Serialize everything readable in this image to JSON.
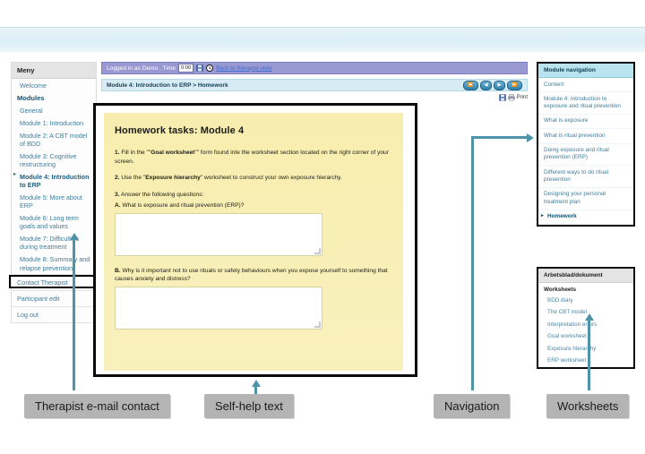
{
  "left_menu": {
    "header": "Meny",
    "welcome": "Welcome",
    "modules_header": "Modules",
    "items": [
      {
        "label": "General",
        "selected": false
      },
      {
        "label": "Module 1: Introduction",
        "selected": false
      },
      {
        "label": "Module 2: A CBT model of BDD",
        "selected": false
      },
      {
        "label": "Module 3: Cognitive restructuring",
        "selected": false
      },
      {
        "label": "Module 4: Introduction to ERP",
        "selected": true
      },
      {
        "label": "Module 5: More about ERP",
        "selected": false
      },
      {
        "label": "Module 6: Long term goals and values",
        "selected": false
      },
      {
        "label": "Module 7: Difficulties during treatment",
        "selected": false
      },
      {
        "label": "Module 8: Summary and relapse prevention",
        "selected": false
      }
    ],
    "footer_items": [
      {
        "label": "Contact Therapist"
      },
      {
        "label": "Participant edit"
      },
      {
        "label": "Log out"
      }
    ]
  },
  "session_bar": {
    "logged_in_text": "Logged in as Demo . Time",
    "time_value": "0:00",
    "save_icon": "save-icon",
    "clock_icon": "clock-icon",
    "back_link": "Back to therapist view"
  },
  "breadcrumb": {
    "text": "Module 4: Introduction to ERP > Homework",
    "nav_buttons": [
      {
        "name": "first-page-button",
        "glyph": "⏪"
      },
      {
        "name": "previous-page-button",
        "glyph": "◀"
      },
      {
        "name": "next-page-button",
        "glyph": "▶"
      },
      {
        "name": "last-page-button",
        "glyph": "⏩"
      }
    ],
    "print_label": "Print",
    "save_icon": "save-icon",
    "print_icon": "printer-icon"
  },
  "homework": {
    "title": "Homework tasks: Module 4",
    "task1_prefix": "1.",
    "task1_a": "Fill in the \"\"",
    "task1_bold": "Goal worksheet",
    "task1_b": "\"\" form found inte the worksheet section located on the right corner of your screen.",
    "task2_prefix": "2.",
    "task2_a": "Use the \"",
    "task2_bold": "Exposure hierarchy",
    "task2_b": "\" worksheet to construct your own exposure hierarchy.",
    "task3_prefix": "3.",
    "task3_text": "Answer the following questions:",
    "qa_label": "A.",
    "qa_text": "What is exposure and ritual prevention (ERP)?",
    "qa_value": "",
    "qb_label": "B.",
    "qb_text": "Why is it important not to use rituals or safety behaviours when you expose yourself to something that causes anxiety and distress?",
    "qb_value": ""
  },
  "module_nav": {
    "header": "Module navigation",
    "items": [
      {
        "label": "Content",
        "selected": false
      },
      {
        "label": "Module 4: Introduction to exposure and ritual prevention",
        "selected": false
      },
      {
        "label": "What is exposure",
        "selected": false
      },
      {
        "label": "What is ritual prevention",
        "selected": false
      },
      {
        "label": "Doing exposure and ritual prevention (ERP)",
        "selected": false
      },
      {
        "label": "Different ways to do ritual prevention",
        "selected": false
      },
      {
        "label": "Designing your personal treatment plan",
        "selected": false
      },
      {
        "label": "Homework",
        "selected": true
      }
    ]
  },
  "worksheets_panel": {
    "header": "Arbetsblad/dokument",
    "subheader": "Worksheets",
    "items": [
      {
        "label": "BDD diary"
      },
      {
        "label": "The CBT model"
      },
      {
        "label": "Interpretation errors"
      },
      {
        "label": "Goal worksheet"
      },
      {
        "label": "Exposure hierarchy"
      },
      {
        "label": "ERP worksheet"
      }
    ]
  },
  "annotations": [
    {
      "label": "Therapist e-mail contact"
    },
    {
      "label": "Self-help text"
    },
    {
      "label": "Navigation"
    },
    {
      "label": "Worksheets"
    }
  ],
  "colors": {
    "session_bar": "#9a98d0",
    "breadcrumb_bar": "#d8ecf5",
    "homework_card": "#f7edae",
    "module_nav_header": "#b9e4ef",
    "callout_bg": "#b4b4b4",
    "arrow": "#4f93a8",
    "link": "#3f7c99"
  }
}
